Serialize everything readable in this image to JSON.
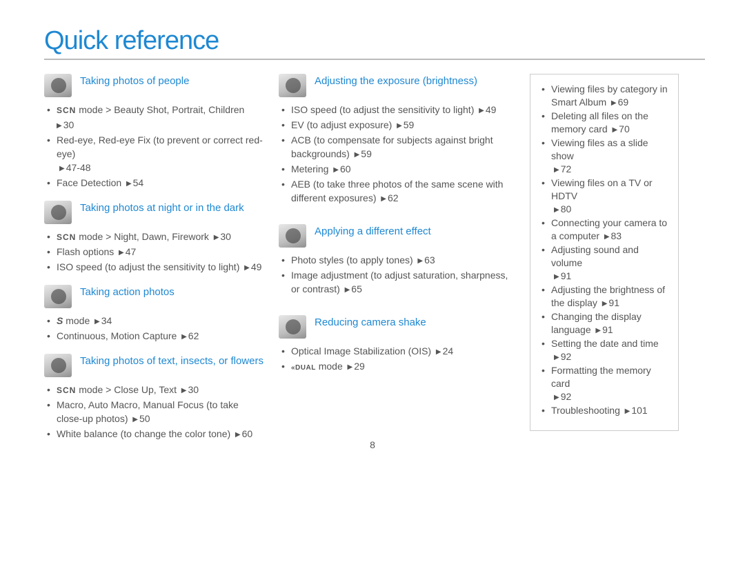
{
  "page": {
    "title": "Quick reference",
    "number": "8"
  },
  "left": {
    "s1": {
      "title": "Taking photos of people",
      "i1_pre_mode": "SCN",
      "i1_a": " mode > Beauty Shot, Portrait, Children",
      "i1_b": "30",
      "i2_a": "Red-eye, Red-eye Fix (to prevent or correct red-eye)",
      "i2_b": "47-48",
      "i3_a": "Face Detection",
      "i3_b": "54"
    },
    "s2": {
      "title": "Taking photos at night or in the dark",
      "i1_pre_mode": "SCN",
      "i1_a": " mode > Night, Dawn, Firework",
      "i1_b": "30",
      "i2_a": "Flash options",
      "i2_b": "47",
      "i3_a": "ISO speed (to adjust the sensitivity to light)",
      "i3_b": "49"
    },
    "s3": {
      "title": "Taking action photos",
      "i1_mode": "S",
      "i1_a": " mode",
      "i1_b": "34",
      "i2_a": "Continuous, Motion Capture",
      "i2_b": "62"
    },
    "s4": {
      "title": "Taking photos of text, insects, or flowers",
      "i1_pre_mode": "SCN",
      "i1_a": " mode > Close Up, Text",
      "i1_b": "30",
      "i2_a": "Macro, Auto Macro, Manual Focus (to take close-up photos)",
      "i2_b": "50",
      "i3_a": "White balance (to change the color tone)",
      "i3_b": "60"
    }
  },
  "middle": {
    "s1": {
      "title": "Adjusting the exposure (brightness)",
      "i1_a": "ISO speed (to adjust the sensitivity to light)",
      "i1_b": "49",
      "i2_a": "EV (to adjust exposure)",
      "i2_b": "59",
      "i3_a": "ACB (to compensate for subjects against bright backgrounds)",
      "i3_b": "59",
      "i4_a": "Metering",
      "i4_b": "60",
      "i5_a": "AEB (to take three photos of the same scene with different exposures)",
      "i5_b": "62"
    },
    "s2": {
      "title": "Applying a different effect",
      "i1_a": "Photo styles (to apply tones)",
      "i1_b": "63",
      "i2_a": "Image adjustment (to adjust saturation, sharpness, or contrast)",
      "i2_b": "65"
    },
    "s3": {
      "title": "Reducing camera shake",
      "i1_a": "Optical Image Stabilization (OIS)",
      "i1_b": "24",
      "i2_mode": "«DUAL",
      "i2_a": " mode",
      "i2_b": "29"
    }
  },
  "side": {
    "i1_a": "Viewing files by category in Smart Album",
    "i1_b": "69",
    "i2_a": "Deleting all files on the memory card",
    "i2_b": "70",
    "i3_a": "Viewing files as a slide show",
    "i3_b": "72",
    "i4_a": "Viewing files on a TV or HDTV",
    "i4_b": "80",
    "i5_a": "Connecting your camera to a computer",
    "i5_b": "83",
    "i6_a": "Adjusting sound and volume",
    "i6_b": "91",
    "i7_a": "Adjusting the brightness of the display",
    "i7_b": "91",
    "i8_a": "Changing the display language",
    "i8_b": "91",
    "i9_a": "Setting the date and time",
    "i9_b": "92",
    "i10_a": "Formatting the memory card",
    "i10_b": "92",
    "i11_a": "Troubleshooting",
    "i11_b": "101"
  }
}
